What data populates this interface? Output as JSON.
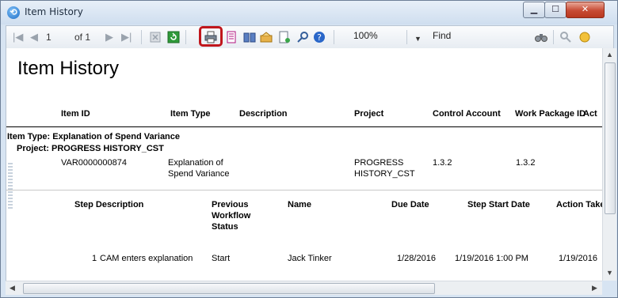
{
  "window": {
    "title": "Item History"
  },
  "toolbar": {
    "page_current": "1",
    "page_of": "of 1",
    "zoom": "100%",
    "find_label": "Find"
  },
  "report": {
    "title": "Item History",
    "columns": [
      "Item ID",
      "Item Type",
      "Description",
      "Project",
      "Control Account",
      "Work Package ID",
      "Act"
    ],
    "group_item_type": "Item Type: Explanation of Spend Variance",
    "group_project": "Project: PROGRESS HISTORY_CST",
    "row": {
      "item_id": "VAR0000000874",
      "item_type_line1": "Explanation of",
      "item_type_line2": "Spend Variance",
      "project_line1": "PROGRESS",
      "project_line2": "HISTORY_CST",
      "control_account": "1.3.2",
      "work_package_id": "1.3.2"
    },
    "step_columns": {
      "step_description": "Step Description",
      "previous_line1": "Previous",
      "previous_line2": "Workflow",
      "previous_line3": "Status",
      "name": "Name",
      "due_date": "Due Date",
      "step_start_date": "Step Start Date",
      "action_taken": "Action Take"
    },
    "step_row": {
      "number": "1",
      "description": "CAM enters explanation",
      "previous_status": "Start",
      "name": "Jack Tinker",
      "due_date": "1/28/2016",
      "step_start_date": "1/19/2016 1:00 PM",
      "action_taken": "1/19/2016"
    }
  },
  "colors": {
    "highlight": "#c0161c",
    "title_bar": "#dbe6f3",
    "close_button": "#c74a33"
  }
}
